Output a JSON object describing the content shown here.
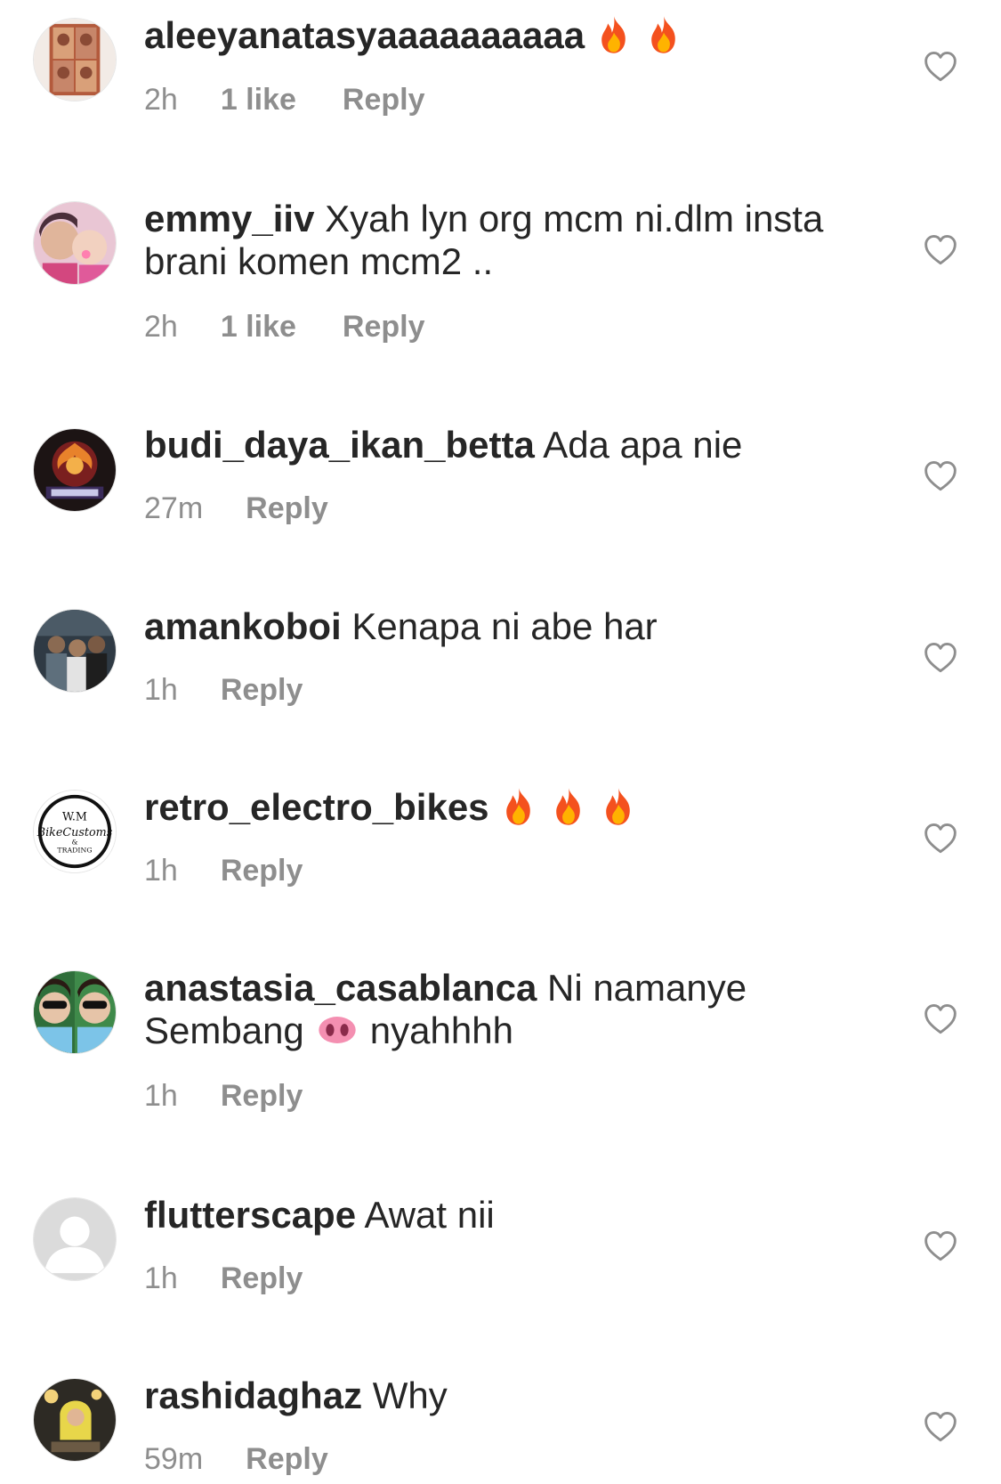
{
  "comments": [
    {
      "username": "aleeyanatasyaaaaaaaaaa",
      "text": "",
      "emojis": [
        "fire-icon",
        "fire-icon"
      ],
      "time": "2h",
      "likes": "1 like",
      "reply_label": "Reply"
    },
    {
      "username": "emmy_iiv",
      "text": "Xyah lyn org mcm ni.dlm insta brani komen mcm2 ..",
      "time": "2h",
      "likes": "1 like",
      "reply_label": "Reply"
    },
    {
      "username": "budi_daya_ikan_betta",
      "text": "Ada apa nie",
      "time": "27m",
      "reply_label": "Reply"
    },
    {
      "username": "amankoboi",
      "text": "Kenapa ni abe har",
      "time": "1h",
      "reply_label": "Reply"
    },
    {
      "username": "retro_electro_bikes",
      "text": "",
      "emojis": [
        "fire-icon",
        "fire-icon",
        "fire-icon"
      ],
      "time": "1h",
      "reply_label": "Reply",
      "avatar_text": [
        "W.M",
        "BikeCustoms",
        "&",
        "TRADING"
      ]
    },
    {
      "username": "anastasia_casablanca",
      "text_before": "Ni namanye Sembang",
      "emoji": "pig-nose-icon",
      "text_after": "nyahhhh",
      "time": "1h",
      "reply_label": "Reply"
    },
    {
      "username": "flutterscape",
      "text": "Awat nii",
      "time": "1h",
      "reply_label": "Reply"
    },
    {
      "username": "rashidaghaz",
      "text": "Why",
      "time": "59m",
      "reply_label": "Reply"
    }
  ],
  "icons": {
    "like": "heart-outline-icon"
  },
  "colors": {
    "primary_text": "#262626",
    "secondary_text": "#8e8e8e",
    "background": "#ffffff"
  }
}
